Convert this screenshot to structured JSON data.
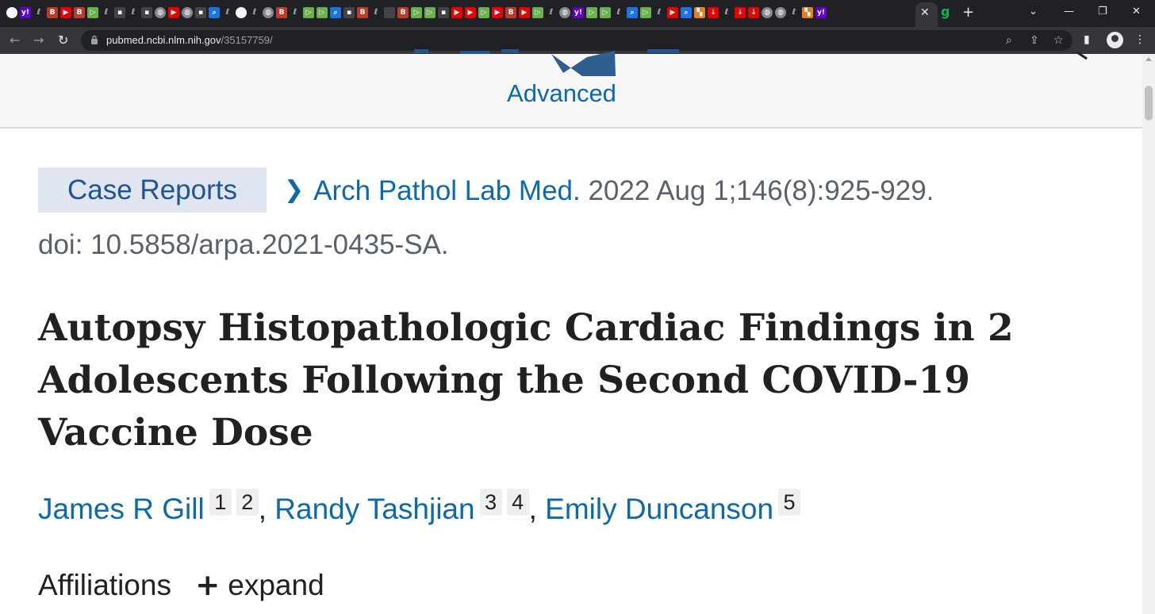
{
  "browser": {
    "tab_favicons": [
      "chrome",
      "yahoo",
      "ult",
      "bi",
      "youtube",
      "bi",
      "play",
      "ult",
      "sq",
      "ult",
      "sq",
      "globe",
      "youtube",
      "globe",
      "sq",
      "search",
      "ult",
      "g",
      "ult",
      "globe",
      "bi",
      "ult",
      "play",
      "play",
      "search",
      "sq",
      "bi",
      "ult",
      "k",
      "bi",
      "play",
      "play",
      "sq",
      "youtube",
      "youtube",
      "play",
      "youtube",
      "bi",
      "youtube",
      "play",
      "ult",
      "globe",
      "yahoo",
      "play",
      "play",
      "ult",
      "search",
      "play",
      "ult",
      "youtube",
      "search",
      "bookmark",
      "red",
      "ult",
      "red",
      "red",
      "globe",
      "globe",
      "ult",
      "bookmark",
      "yahoo"
    ],
    "close_tab_glyph": "✕",
    "new_tab_glyph": "+",
    "url_host": "pubmed.ncbi.nlm.nih.gov",
    "url_path": "/35157759/"
  },
  "header": {
    "advanced_link": "Advanced"
  },
  "article": {
    "publication_type": "Case Reports",
    "journal": "Arch Pathol Lab Med.",
    "citation": "2022 Aug 1;146(8):925-929.",
    "doi": "doi: 10.5858/arpa.2021-0435-SA.",
    "title": "Autopsy Histopathologic Cardiac Findings in 2 Adolescents Following the Second COVID-19 Vaccine Dose",
    "authors": [
      {
        "name": "James R Gill",
        "affs": [
          "1",
          "2"
        ]
      },
      {
        "name": "Randy Tashjian",
        "affs": [
          "3",
          "4"
        ]
      },
      {
        "name": "Emily Duncanson",
        "affs": [
          "5"
        ]
      }
    ],
    "separator": ",",
    "affiliations_label": "Affiliations",
    "expand_label": "expand"
  }
}
